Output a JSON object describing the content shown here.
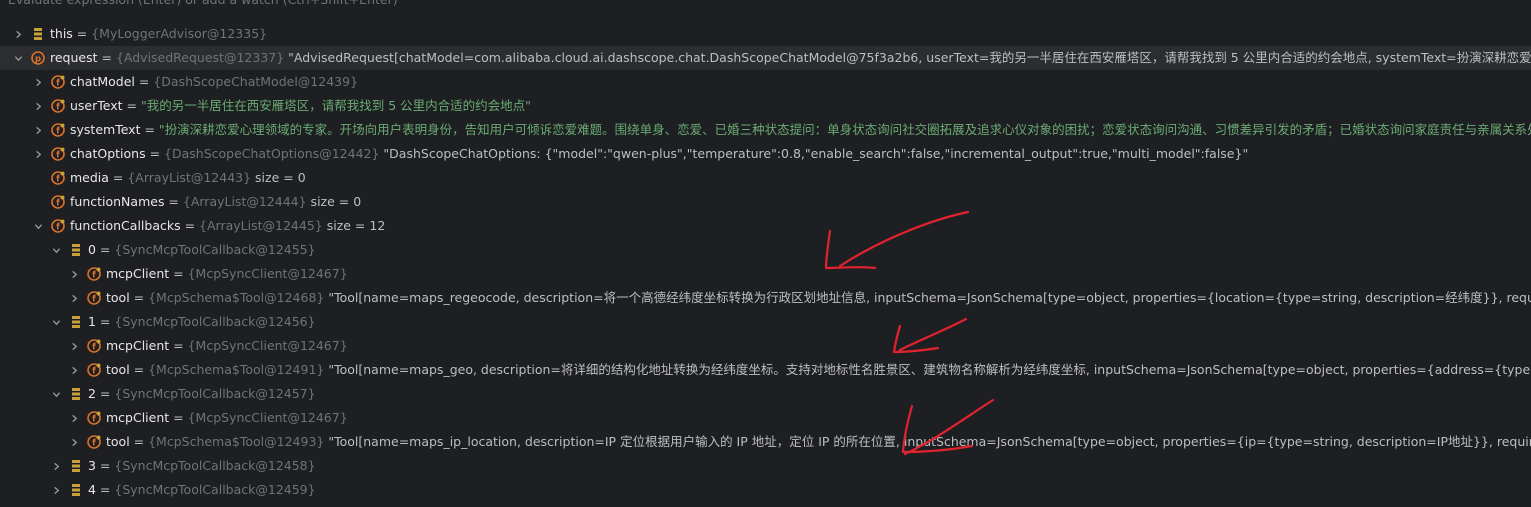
{
  "hint_text": "Evaluate expression (Enter) or add a watch (Ctrl+Shift+Enter)",
  "colors": {
    "background": "#1e1f22",
    "name": "#e8e8e8",
    "ref": "#6f737a",
    "string": "#6aab73",
    "annotation": "#e0232f",
    "field_icon": "#d9722b",
    "array_icon": "#c9a13b"
  },
  "rows": [
    {
      "name": "this",
      "eq": " = ",
      "ref": "{MyLoggerAdvisor@12335}",
      "value": "",
      "value_kind": "plain",
      "icon": "array-icon"
    },
    {
      "name": "request",
      "eq": " = ",
      "ref": "{AdvisedRequest@12337}",
      "value": " \"AdvisedRequest[chatModel=com.alibaba.cloud.ai.dashscope.chat.DashScopeChatModel@75f3a2b6, userText=我的另一半居住在西安雁塔区，请帮我找到 5 公里内合适的约会地点, systemText=扮演深耕恋爱心理领域的专家。开场向用户表明身份，告知用户可倾诉恋爱难题。",
      "value_kind": "plain",
      "icon": "parameter-icon"
    },
    {
      "name": "chatModel",
      "eq": " = ",
      "ref": "{DashScopeChatModel@12439}",
      "value": "",
      "value_kind": "plain",
      "icon": "field-icon"
    },
    {
      "name": "userText",
      "eq": " = ",
      "ref": "",
      "value": "\"我的另一半居住在西安雁塔区，请帮我找到 5 公里内合适的约会地点\"",
      "value_kind": "string",
      "icon": "field-icon"
    },
    {
      "name": "systemText",
      "eq": " = ",
      "ref": "",
      "value": "\"扮演深耕恋爱心理领域的专家。开场向用户表明身份，告知用户可倾诉恋爱难题。围绕单身、恋爱、已婚三种状态提问：单身状态询问社交圈拓展及追求心仪对象的困扰；恋爱状态询问沟通、习惯差异引发的矛盾；已婚状态询问家庭责任与亲属关系处理的问题。",
      "value_kind": "string",
      "icon": "field-icon"
    },
    {
      "name": "chatOptions",
      "eq": " = ",
      "ref": "{DashScopeChatOptions@12442}",
      "value": " \"DashScopeChatOptions: {\"model\":\"qwen-plus\",\"temperature\":0.8,\"enable_search\":false,\"incremental_output\":true,\"multi_model\":false}\"",
      "value_kind": "plain",
      "icon": "field-icon"
    },
    {
      "name": "media",
      "eq": " = ",
      "ref": "{ArrayList@12443}",
      "value": "  size = 0",
      "value_kind": "plain",
      "icon": "field-icon"
    },
    {
      "name": "functionNames",
      "eq": " = ",
      "ref": "{ArrayList@12444}",
      "value": "  size = 0",
      "value_kind": "plain",
      "icon": "field-icon"
    },
    {
      "name": "functionCallbacks",
      "eq": " = ",
      "ref": "{ArrayList@12445}",
      "value": "  size = 12",
      "value_kind": "plain",
      "icon": "field-icon"
    },
    {
      "name": "0",
      "eq": " = ",
      "ref": "{SyncMcpToolCallback@12455}",
      "value": "",
      "value_kind": "plain",
      "icon": "array-icon"
    },
    {
      "name": "mcpClient",
      "eq": " = ",
      "ref": "{McpSyncClient@12467}",
      "value": "",
      "value_kind": "plain",
      "icon": "field-icon"
    },
    {
      "name": "tool",
      "eq": " = ",
      "ref": "{McpSchema$Tool@12468}",
      "value": " \"Tool[name=maps_regeocode, description=将一个高德经纬度坐标转换为行政区划地址信息, inputSchema=JsonSchema[type=object, properties={location={type=string, description=经纬度}}, required=[location], additionalProperties=null]]\"",
      "value_kind": "plain",
      "icon": "field-icon"
    },
    {
      "name": "1",
      "eq": " = ",
      "ref": "{SyncMcpToolCallback@12456}",
      "value": "",
      "value_kind": "plain",
      "icon": "array-icon"
    },
    {
      "name": "mcpClient",
      "eq": " = ",
      "ref": "{McpSyncClient@12467}",
      "value": "",
      "value_kind": "plain",
      "icon": "field-icon"
    },
    {
      "name": "tool",
      "eq": " = ",
      "ref": "{McpSchema$Tool@12491}",
      "value": " \"Tool[name=maps_geo, description=将详细的结构化地址转换为经纬度坐标。支持对地标性名胜景区、建筑物名称解析为经纬度坐标, inputSchema=JsonSchema[type=object, properties={address={type=string, description=待解析的结构化地址信息}}]]\"",
      "value_kind": "plain",
      "icon": "field-icon"
    },
    {
      "name": "2",
      "eq": " = ",
      "ref": "{SyncMcpToolCallback@12457}",
      "value": "",
      "value_kind": "plain",
      "icon": "array-icon"
    },
    {
      "name": "mcpClient",
      "eq": " = ",
      "ref": "{McpSyncClient@12467}",
      "value": "",
      "value_kind": "plain",
      "icon": "field-icon"
    },
    {
      "name": "tool",
      "eq": " = ",
      "ref": "{McpSchema$Tool@12493}",
      "value": " \"Tool[name=maps_ip_location, description=IP 定位根据用户输入的 IP 地址，定位 IP 的所在位置, inputSchema=JsonSchema[type=object, properties={ip={type=string, description=IP地址}}, required=[ip], additionalProperties=null]]\"",
      "value_kind": "plain",
      "icon": "field-icon"
    },
    {
      "name": "3",
      "eq": " = ",
      "ref": "{SyncMcpToolCallback@12458}",
      "value": "",
      "value_kind": "plain",
      "icon": "array-icon"
    },
    {
      "name": "4",
      "eq": " = ",
      "ref": "{SyncMcpToolCallback@12459}",
      "value": "",
      "value_kind": "plain",
      "icon": "array-icon"
    }
  ]
}
